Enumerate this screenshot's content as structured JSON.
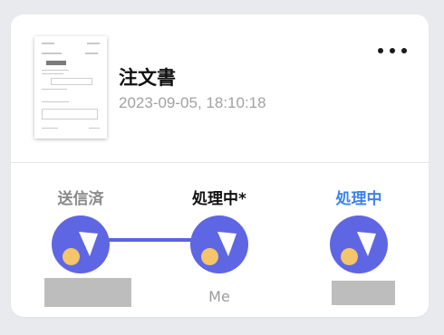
{
  "document": {
    "title": "注文書",
    "date": "2023-09-05, 18:10:18"
  },
  "steps": [
    {
      "label": "送信済",
      "color": "#8a8a8a",
      "assignee": ""
    },
    {
      "label": "処理中*",
      "color": "#111111",
      "assignee": "Me"
    },
    {
      "label": "処理中",
      "color": "#3d82f0",
      "assignee": ""
    }
  ],
  "icons": {
    "menu": "more-horizontal-icon",
    "avatar": "workflow-avatar-icon"
  },
  "colors": {
    "accent": "#5f66e4",
    "avatar_dot": "#f4c56a",
    "connector": "#5c63e0"
  }
}
